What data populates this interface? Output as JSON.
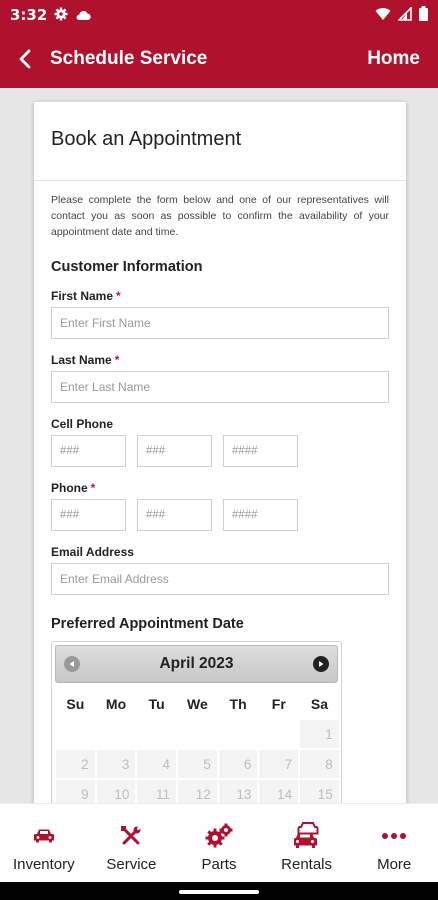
{
  "status_bar": {
    "time": "3:32"
  },
  "app_bar": {
    "title": "Schedule Service",
    "home_label": "Home"
  },
  "form": {
    "title": "Book an Appointment",
    "intro": "Please complete the form below and one of our representatives will contact you as soon as possible to confirm the availability of your appointment date and time.",
    "customer_section": "Customer Information",
    "first_name": {
      "label": "First Name",
      "required": "*",
      "placeholder": "Enter First Name"
    },
    "last_name": {
      "label": "Last Name",
      "required": "*",
      "placeholder": "Enter Last Name"
    },
    "cell_phone": {
      "label": "Cell Phone",
      "p1": "###",
      "p2": "###",
      "p3": "####"
    },
    "phone": {
      "label": "Phone",
      "required": "*",
      "p1": "###",
      "p2": "###",
      "p3": "####"
    },
    "email": {
      "label": "Email Address",
      "placeholder": "Enter Email Address"
    },
    "date_section": "Preferred Appointment Date"
  },
  "calendar": {
    "month": "April 2023",
    "weekdays": [
      "Su",
      "Mo",
      "Tu",
      "We",
      "Th",
      "Fr",
      "Sa"
    ],
    "weeks": [
      [
        "",
        "",
        "",
        "",
        "",
        "",
        "1"
      ],
      [
        "2",
        "3",
        "4",
        "5",
        "6",
        "7",
        "8"
      ],
      [
        "9",
        "10",
        "11",
        "12",
        "13",
        "14",
        "15"
      ]
    ]
  },
  "bottom_nav": [
    {
      "label": "Inventory",
      "icon": "car-icon"
    },
    {
      "label": "Service",
      "icon": "wrench-icon"
    },
    {
      "label": "Parts",
      "icon": "gears-icon"
    },
    {
      "label": "Rentals",
      "icon": "rental-cars-icon"
    },
    {
      "label": "More",
      "icon": "more-dots-icon"
    }
  ],
  "colors": {
    "brand": "#b0112d",
    "required": "#c8102e"
  }
}
